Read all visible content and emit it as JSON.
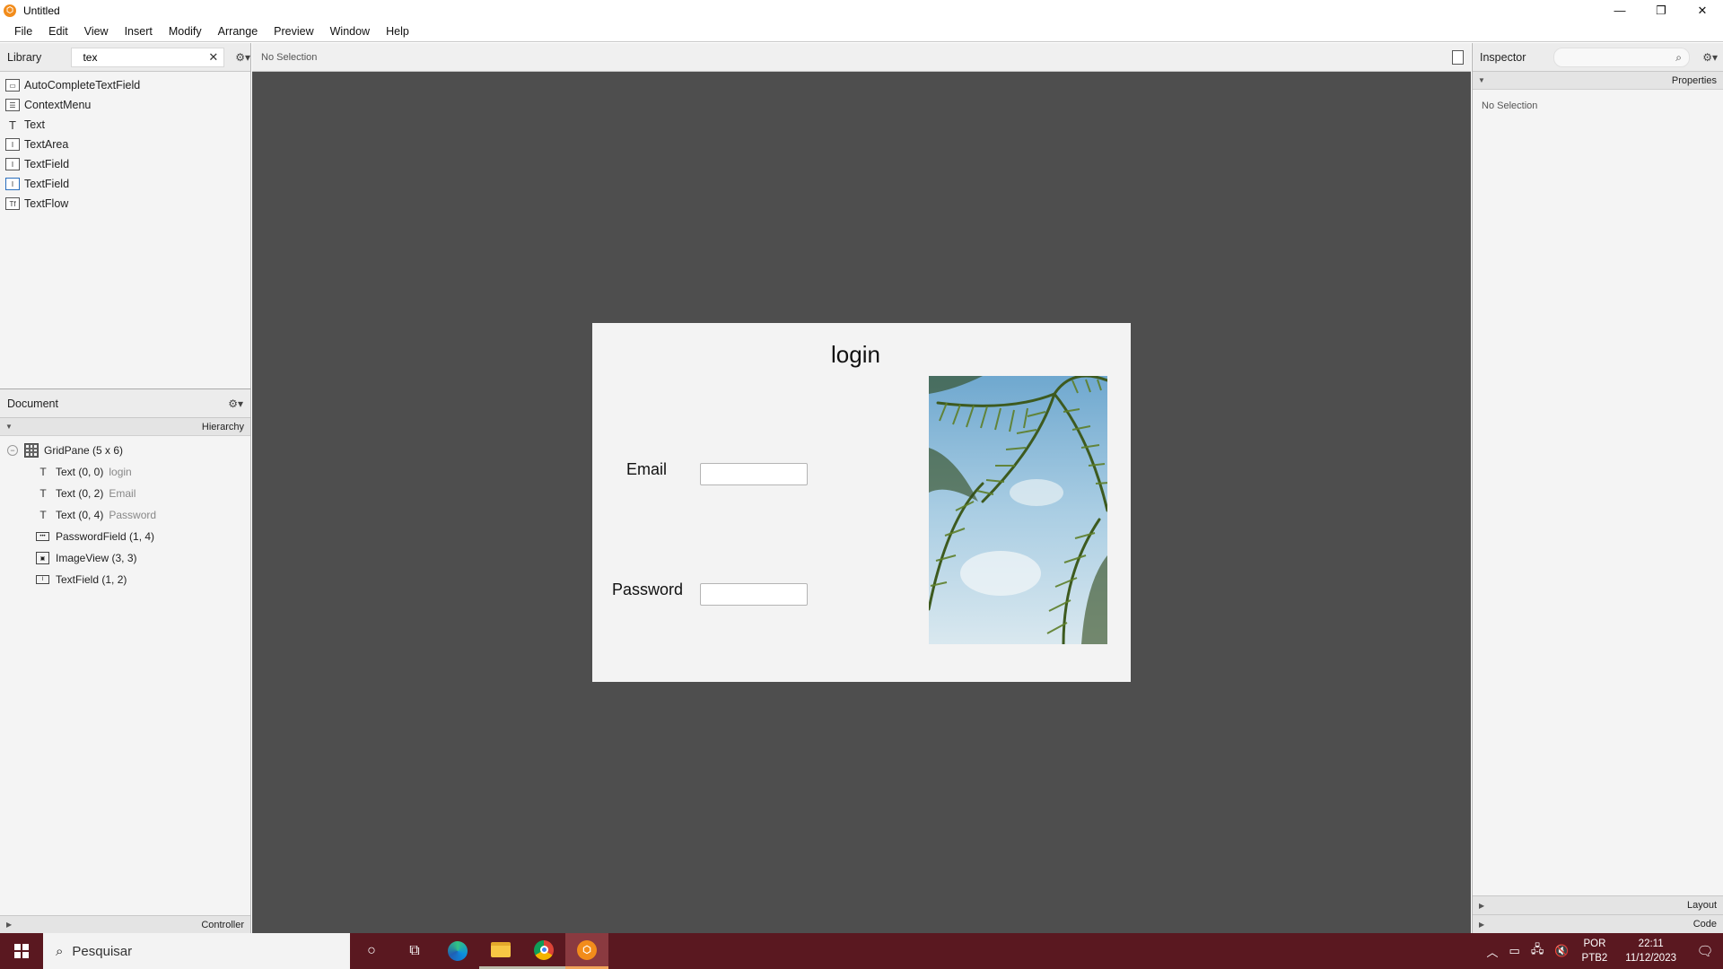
{
  "window": {
    "title": "Untitled",
    "minimize": "—",
    "maximize": "❐",
    "close": "✕"
  },
  "menu": [
    "File",
    "Edit",
    "View",
    "Insert",
    "Modify",
    "Arrange",
    "Preview",
    "Window",
    "Help"
  ],
  "library": {
    "title": "Library",
    "search_value": "tex",
    "items": [
      "AutoCompleteTextField",
      "ContextMenu",
      "Text",
      "TextArea",
      "TextField",
      "TextField",
      "TextFlow"
    ]
  },
  "document": {
    "title": "Document",
    "hierarchy_label": "Hierarchy",
    "root": "GridPane (5 x 6)",
    "children": [
      {
        "label": "Text (0, 0)",
        "sub": "login"
      },
      {
        "label": "Text (0, 2)",
        "sub": "Email"
      },
      {
        "label": "Text (0, 4)",
        "sub": "Password"
      },
      {
        "label": "PasswordField (1, 4)",
        "sub": ""
      },
      {
        "label": "ImageView (3, 3)",
        "sub": ""
      },
      {
        "label": "TextField (1, 2)",
        "sub": ""
      }
    ],
    "controller_label": "Controller"
  },
  "canvas": {
    "selection": "No Selection",
    "form": {
      "title": "login",
      "email_label": "Email",
      "password_label": "Password"
    }
  },
  "inspector": {
    "title": "Inspector",
    "properties_label": "Properties",
    "empty": "No Selection",
    "layout_label": "Layout",
    "code_label": "Code"
  },
  "taskbar": {
    "search_placeholder": "Pesquisar",
    "lang_top": "POR",
    "lang_bottom": "PTB2",
    "time": "22:11",
    "date": "11/12/2023"
  },
  "colors": {
    "taskbar": "#5a1820",
    "canvas": "#4e4e4e",
    "form": "#f3f3f3",
    "accent": "#f28c1b"
  }
}
